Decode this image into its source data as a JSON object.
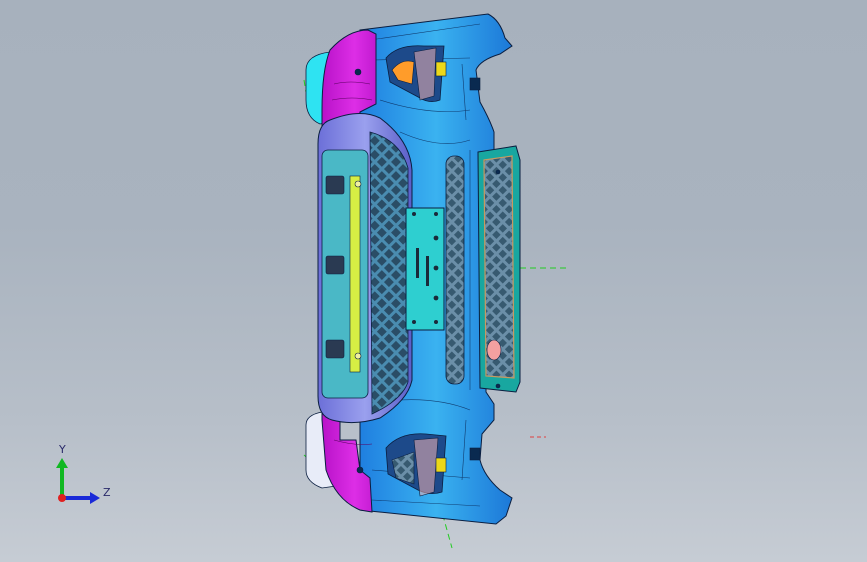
{
  "viewport": {
    "model": "front-bumper-assembly",
    "colors": {
      "background_top": "#a7b1bd",
      "background_bottom": "#c6ccd4",
      "bumper_left_face": "#d01ed8",
      "bumper_main_body": "#1e88e8",
      "bumper_main_body_light": "#3db1f2",
      "fog_light_lens": "#5dc8d8",
      "grille_mesh": "#2f5f80",
      "grille_frame": "#7a7ae0",
      "plate_mount": "#2ed0d0",
      "corner_tip": "#2de0f0",
      "edge_lines": "#0a1e40",
      "accent_orange": "#ff9a2e",
      "accent_yellow": "#e8e01a",
      "reflector_pink": "#f4a0a0",
      "axis_centerline": "#22cc22"
    }
  },
  "triad": {
    "y_label": "Y",
    "z_label": "Z",
    "colors": {
      "y": "#11b822",
      "z": "#1a2ad8",
      "origin": "#e02020"
    }
  }
}
